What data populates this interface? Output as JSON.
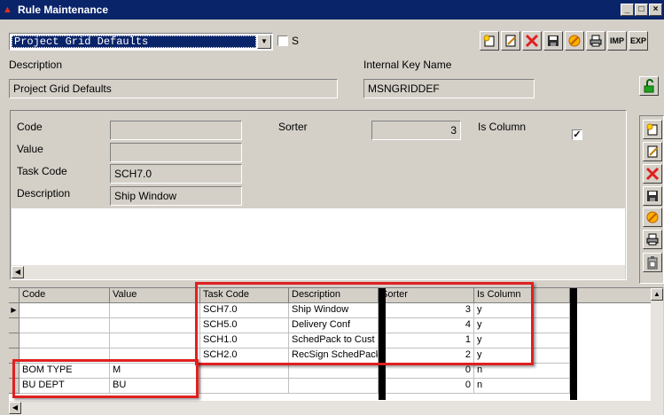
{
  "window": {
    "title": "Rule Maintenance"
  },
  "top": {
    "profile_value": "Project Grid Defaults",
    "s_label": "S",
    "description_label": "Description",
    "description_value": "Project Grid Defaults",
    "internal_key_label": "Internal Key Name",
    "internal_key_value": "MSNGRIDDEF",
    "imp_label": "IMP",
    "exp_label": "EXP"
  },
  "detail": {
    "code_label": "Code",
    "code_value": "",
    "value_label": "Value",
    "value_value": "",
    "task_code_label": "Task Code",
    "task_code_value": "SCH7.0",
    "description_label": "Description",
    "description_value": "Ship Window",
    "sorter_label": "Sorter",
    "sorter_value": "3",
    "is_column_label": "Is Column",
    "is_column_checked": true
  },
  "grid": {
    "headers": [
      "Code",
      "Value",
      "Task Code",
      "Description",
      "Sorter",
      "Is Column"
    ],
    "rows": [
      {
        "code": "",
        "value": "",
        "task_code": "SCH7.0",
        "description": "Ship Window",
        "sorter": "3",
        "is_column": "y"
      },
      {
        "code": "",
        "value": "",
        "task_code": "SCH5.0",
        "description": "Delivery Conf",
        "sorter": "4",
        "is_column": "y"
      },
      {
        "code": "",
        "value": "",
        "task_code": "SCH1.0",
        "description": "SchedPack to Cust",
        "sorter": "1",
        "is_column": "y"
      },
      {
        "code": "",
        "value": "",
        "task_code": "SCH2.0",
        "description": "RecSign SchedPack",
        "sorter": "2",
        "is_column": "y"
      },
      {
        "code": "BOM TYPE",
        "value": "M",
        "task_code": "",
        "description": "",
        "sorter": "0",
        "is_column": "n"
      },
      {
        "code": "BU DEPT",
        "value": "BU",
        "task_code": "",
        "description": "",
        "sorter": "0",
        "is_column": "n"
      }
    ]
  },
  "colors": {
    "highlight_red": "#e02020",
    "titlebar": "#0a246a"
  }
}
